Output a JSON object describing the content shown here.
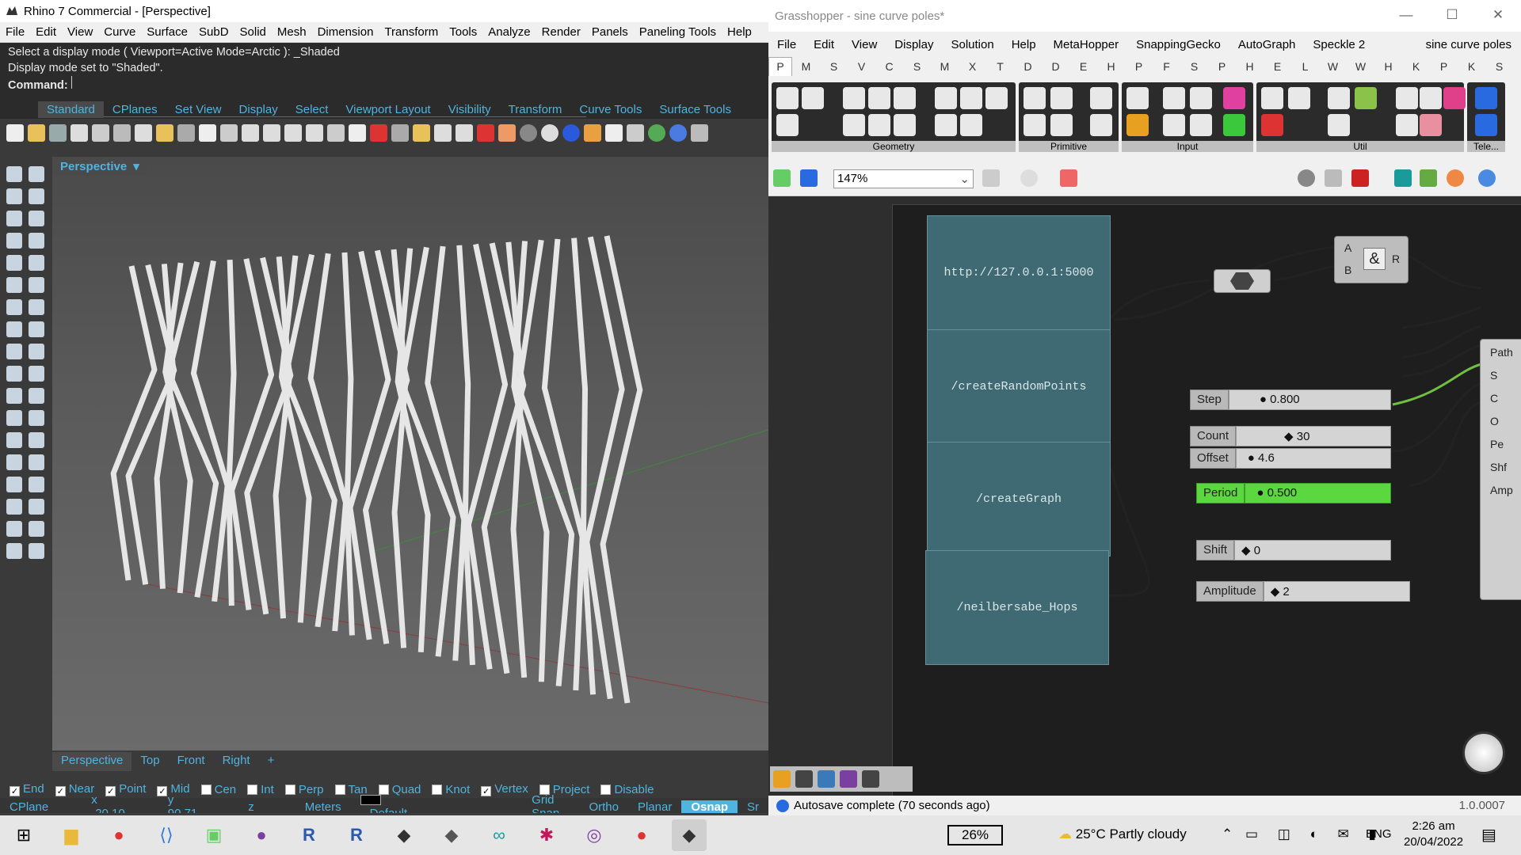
{
  "rhino": {
    "title": "Rhino 7 Commercial - [Perspective]",
    "menu": [
      "File",
      "Edit",
      "View",
      "Curve",
      "Surface",
      "SubD",
      "Solid",
      "Mesh",
      "Dimension",
      "Transform",
      "Tools",
      "Analyze",
      "Render",
      "Panels",
      "Paneling Tools",
      "Help"
    ],
    "cmd_line1": "Select a display mode ( Viewport=Active  Mode=Arctic ): _Shaded",
    "cmd_line2": "Display mode set to \"Shaded\".",
    "cmd_label": "Command:",
    "toolbar_tabs": [
      "Standard",
      "CPlanes",
      "Set View",
      "Display",
      "Select",
      "Viewport Layout",
      "Visibility",
      "Transform",
      "Curve Tools",
      "Surface Tools"
    ],
    "viewport_title": "Perspective",
    "viewport_tabs": [
      "Perspective",
      "Top",
      "Front",
      "Right",
      "+"
    ],
    "osnap": [
      {
        "label": "End",
        "checked": true
      },
      {
        "label": "Near",
        "checked": true
      },
      {
        "label": "Point",
        "checked": true
      },
      {
        "label": "Mid",
        "checked": true
      },
      {
        "label": "Cen",
        "checked": false
      },
      {
        "label": "Int",
        "checked": false
      },
      {
        "label": "Perp",
        "checked": false
      },
      {
        "label": "Tan",
        "checked": false
      },
      {
        "label": "Quad",
        "checked": false
      },
      {
        "label": "Knot",
        "checked": false
      },
      {
        "label": "Vertex",
        "checked": true
      },
      {
        "label": "Project",
        "checked": false
      },
      {
        "label": "Disable",
        "checked": false
      }
    ],
    "status": {
      "cplane": "CPlane",
      "x": "x -20.10",
      "y": "y 90.71",
      "z": "z",
      "units": "Meters",
      "layer": "Default",
      "grid_snap": "Grid Snap",
      "ortho": "Ortho",
      "planar": "Planar",
      "osnap": "Osnap",
      "sm": "Sr"
    }
  },
  "gh": {
    "title": "Grasshopper - sine curve poles*",
    "menu": [
      "File",
      "Edit",
      "View",
      "Display",
      "Solution",
      "Help",
      "MetaHopper",
      "SnappingGecko",
      "AutoGraph",
      "Speckle 2"
    ],
    "doc_name": "sine curve poles",
    "tabs": [
      "P",
      "M",
      "S",
      "V",
      "C",
      "S",
      "M",
      "X",
      "T",
      "D",
      "D",
      "E",
      "H",
      "P",
      "F",
      "S",
      "P",
      "H",
      "E",
      "L",
      "W",
      "W",
      "H",
      "K",
      "P",
      "K",
      "S"
    ],
    "ribbon_groups": [
      "Geometry",
      "Primitive",
      "Input",
      "Util",
      "Tele..."
    ],
    "zoom": "147%",
    "nodes": [
      "http://127.0.0.1:5000",
      "/createRandomPoints",
      "/createGraph",
      "/neilbersabe_Hops"
    ],
    "and_node": {
      "a": "A",
      "b": "B",
      "r": "R",
      "symbol": "&"
    },
    "sliders": [
      {
        "name": "Step",
        "value": "0.800"
      },
      {
        "name": "Count",
        "value": "30"
      },
      {
        "name": "Offset",
        "value": "4.6"
      },
      {
        "name": "Period",
        "value": "0.500"
      },
      {
        "name": "Shift",
        "value": "0"
      },
      {
        "name": "Amplitude",
        "value": "2"
      }
    ],
    "inputs": [
      "Path",
      "S",
      "C",
      "O",
      "Pe",
      "Shf",
      "Amp"
    ],
    "status": "Autosave complete (70 seconds ago)",
    "version": "1.0.0007"
  },
  "taskbar": {
    "battery": "26%",
    "weather": "25°C  Partly cloudy",
    "lang": "ENG",
    "time": "2:26 am",
    "date": "20/04/2022"
  }
}
